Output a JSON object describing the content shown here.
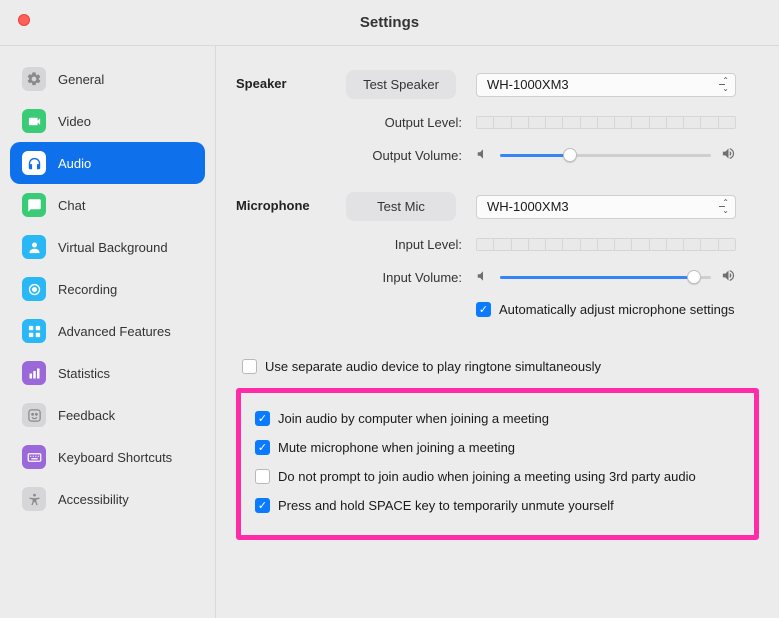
{
  "window": {
    "title": "Settings"
  },
  "sidebar": {
    "items": [
      {
        "id": "general",
        "label": "General",
        "icon": "gear",
        "bg": "#d6d6d8",
        "fg": "#8a8a8d"
      },
      {
        "id": "video",
        "label": "Video",
        "icon": "video",
        "bg": "#39cb75",
        "fg": "#ffffff"
      },
      {
        "id": "audio",
        "label": "Audio",
        "icon": "headphones",
        "bg": "#ffffff",
        "fg": "#0e71eb",
        "active": true
      },
      {
        "id": "chat",
        "label": "Chat",
        "icon": "chat",
        "bg": "#39cb75",
        "fg": "#ffffff"
      },
      {
        "id": "vbg",
        "label": "Virtual Background",
        "icon": "person",
        "bg": "#29b8f5",
        "fg": "#ffffff"
      },
      {
        "id": "recording",
        "label": "Recording",
        "icon": "record",
        "bg": "#29b8f5",
        "fg": "#ffffff"
      },
      {
        "id": "advanced",
        "label": "Advanced Features",
        "icon": "grid",
        "bg": "#29b8f5",
        "fg": "#ffffff"
      },
      {
        "id": "stats",
        "label": "Statistics",
        "icon": "chart",
        "bg": "#9a68d9",
        "fg": "#ffffff"
      },
      {
        "id": "feedback",
        "label": "Feedback",
        "icon": "face",
        "bg": "#d6d6d8",
        "fg": "#8a8a8d"
      },
      {
        "id": "shortcuts",
        "label": "Keyboard Shortcuts",
        "icon": "keyboard",
        "bg": "#9a68d9",
        "fg": "#ffffff"
      },
      {
        "id": "accessibility",
        "label": "Accessibility",
        "icon": "access",
        "bg": "#d6d6d8",
        "fg": "#8a8a8d"
      }
    ]
  },
  "speaker": {
    "label": "Speaker",
    "test_button": "Test Speaker",
    "device": "WH-1000XM3",
    "output_level_label": "Output Level:",
    "output_volume_label": "Output Volume:",
    "volume_percent": 33
  },
  "microphone": {
    "label": "Microphone",
    "test_button": "Test Mic",
    "device": "WH-1000XM3",
    "input_level_label": "Input Level:",
    "input_volume_label": "Input Volume:",
    "volume_percent": 92,
    "auto_adjust": {
      "checked": true,
      "label": "Automatically adjust microphone settings"
    }
  },
  "separate_audio": {
    "checked": false,
    "label": "Use separate audio device to play ringtone simultaneously"
  },
  "options": [
    {
      "checked": true,
      "label": "Join audio by computer when joining a meeting"
    },
    {
      "checked": true,
      "label": "Mute microphone when joining a meeting"
    },
    {
      "checked": false,
      "label": "Do not prompt to join audio when joining a meeting using 3rd party audio"
    },
    {
      "checked": true,
      "label": "Press and hold SPACE key to temporarily unmute yourself"
    }
  ]
}
